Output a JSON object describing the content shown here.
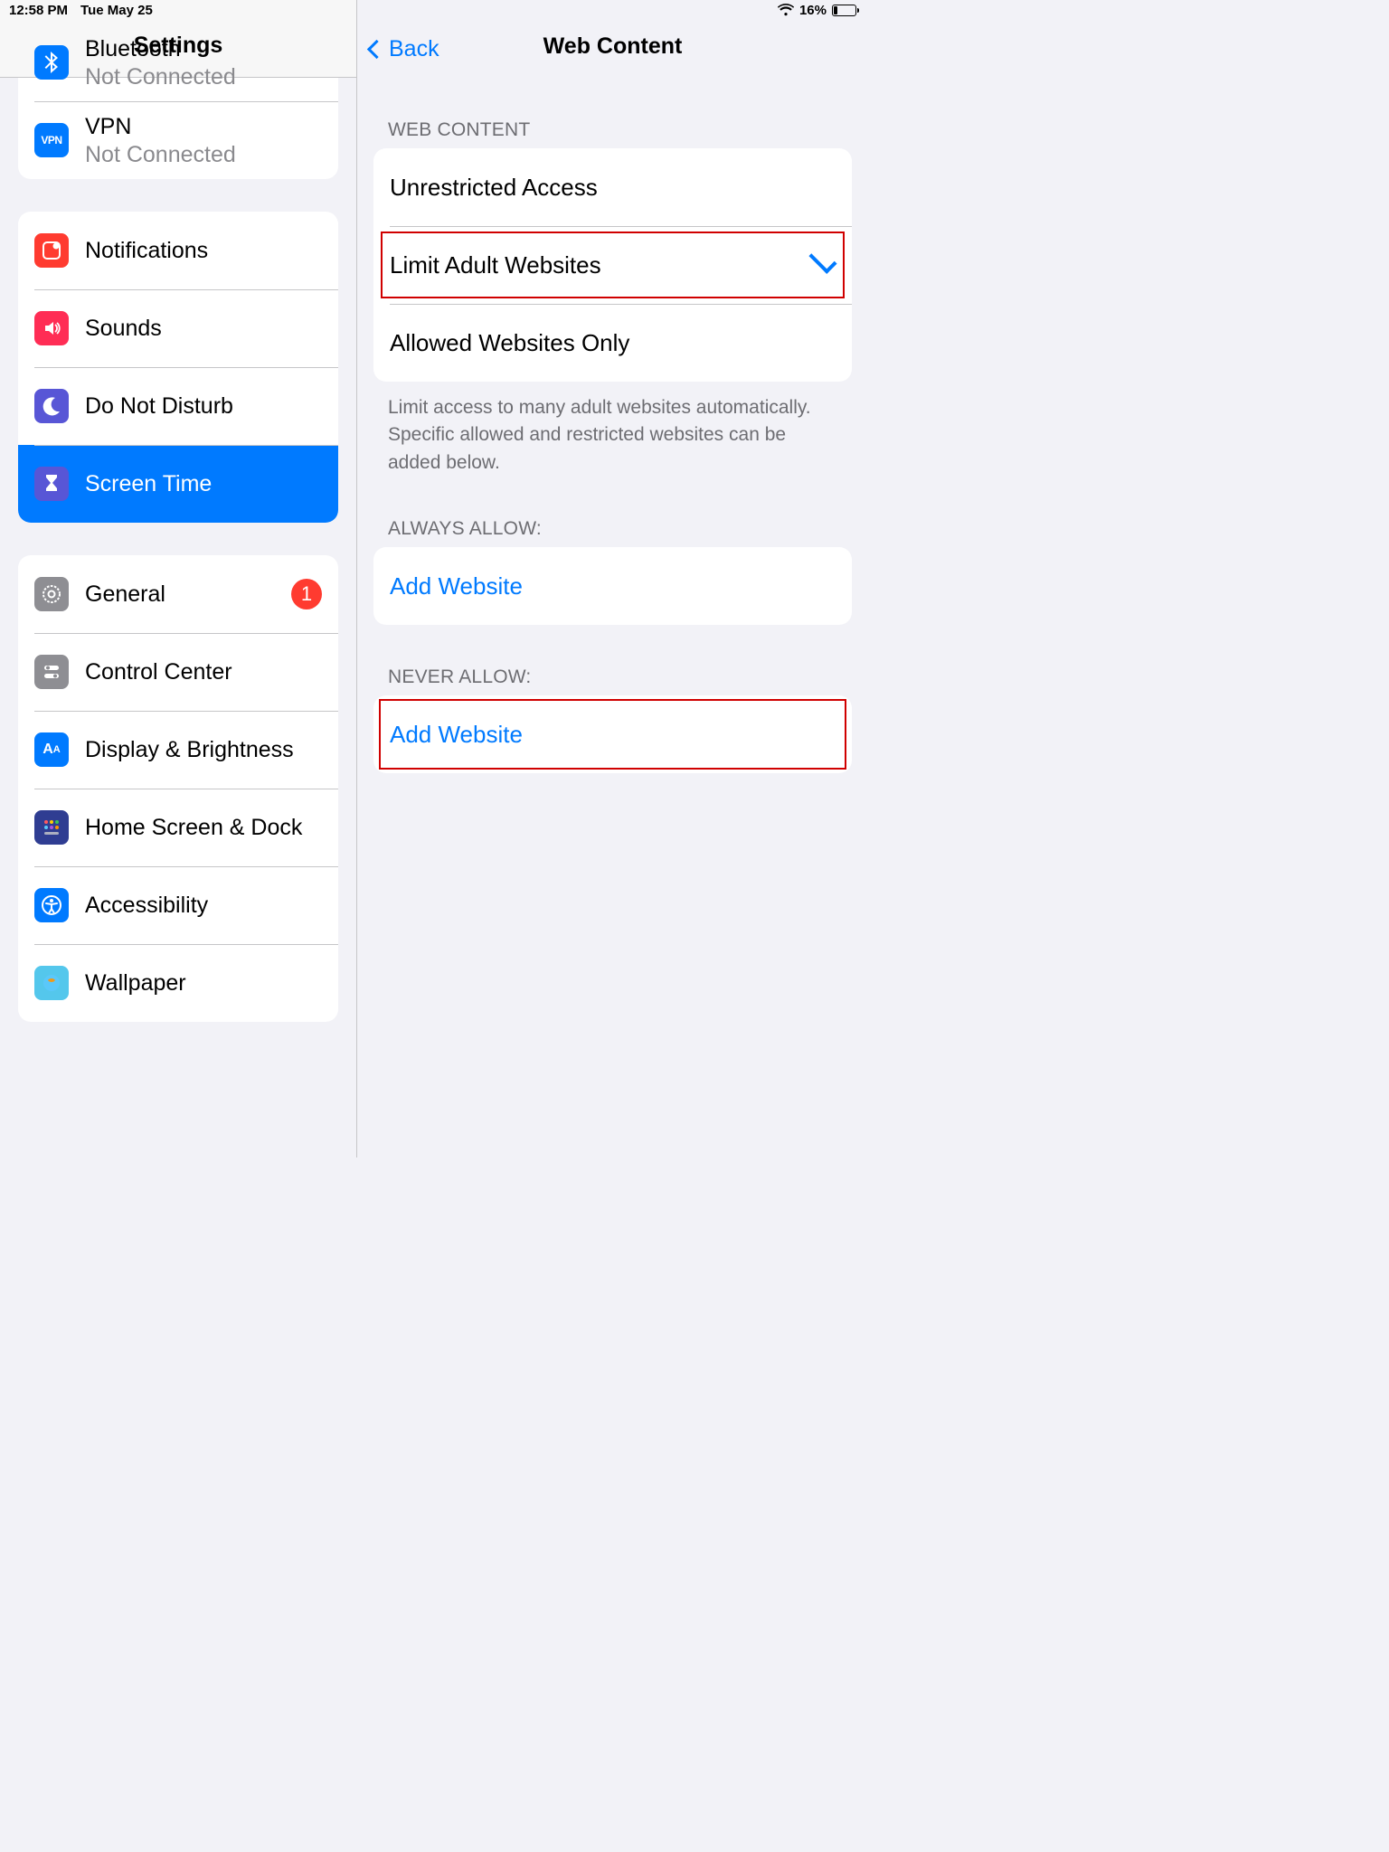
{
  "status": {
    "time": "12:58 PM",
    "date": "Tue May 25",
    "battery_pct": "16%",
    "battery_fill_pct": 16
  },
  "sidebar": {
    "title": "Settings",
    "groups": [
      {
        "items": [
          {
            "icon": "bluetooth",
            "label": "Bluetooth",
            "subtitle": "Not Connected"
          },
          {
            "icon": "vpn",
            "label": "VPN",
            "subtitle": "Not Connected"
          }
        ]
      },
      {
        "items": [
          {
            "icon": "notifications",
            "label": "Notifications"
          },
          {
            "icon": "sounds",
            "label": "Sounds"
          },
          {
            "icon": "dnd",
            "label": "Do Not Disturb"
          },
          {
            "icon": "screentime",
            "label": "Screen Time",
            "selected": true
          }
        ]
      },
      {
        "items": [
          {
            "icon": "general",
            "label": "General",
            "badge": "1"
          },
          {
            "icon": "controlcenter",
            "label": "Control Center"
          },
          {
            "icon": "display",
            "label": "Display & Brightness"
          },
          {
            "icon": "homescreen",
            "label": "Home Screen & Dock"
          },
          {
            "icon": "accessibility",
            "label": "Accessibility"
          },
          {
            "icon": "wallpaper",
            "label": "Wallpaper"
          }
        ]
      }
    ]
  },
  "detail": {
    "back_label": "Back",
    "title": "Web Content",
    "sections": {
      "web_content": {
        "header": "WEB CONTENT",
        "options": [
          {
            "label": "Unrestricted Access",
            "checked": false,
            "highlight": false
          },
          {
            "label": "Limit Adult Websites",
            "checked": true,
            "highlight": true
          },
          {
            "label": "Allowed Websites Only",
            "checked": false,
            "highlight": false
          }
        ],
        "footer": "Limit access to many adult websites automatically. Specific allowed and restricted websites can be added below."
      },
      "always_allow": {
        "header": "ALWAYS ALLOW:",
        "add_label": "Add Website",
        "highlight": false
      },
      "never_allow": {
        "header": "NEVER ALLOW:",
        "add_label": "Add Website",
        "highlight": true
      }
    }
  }
}
